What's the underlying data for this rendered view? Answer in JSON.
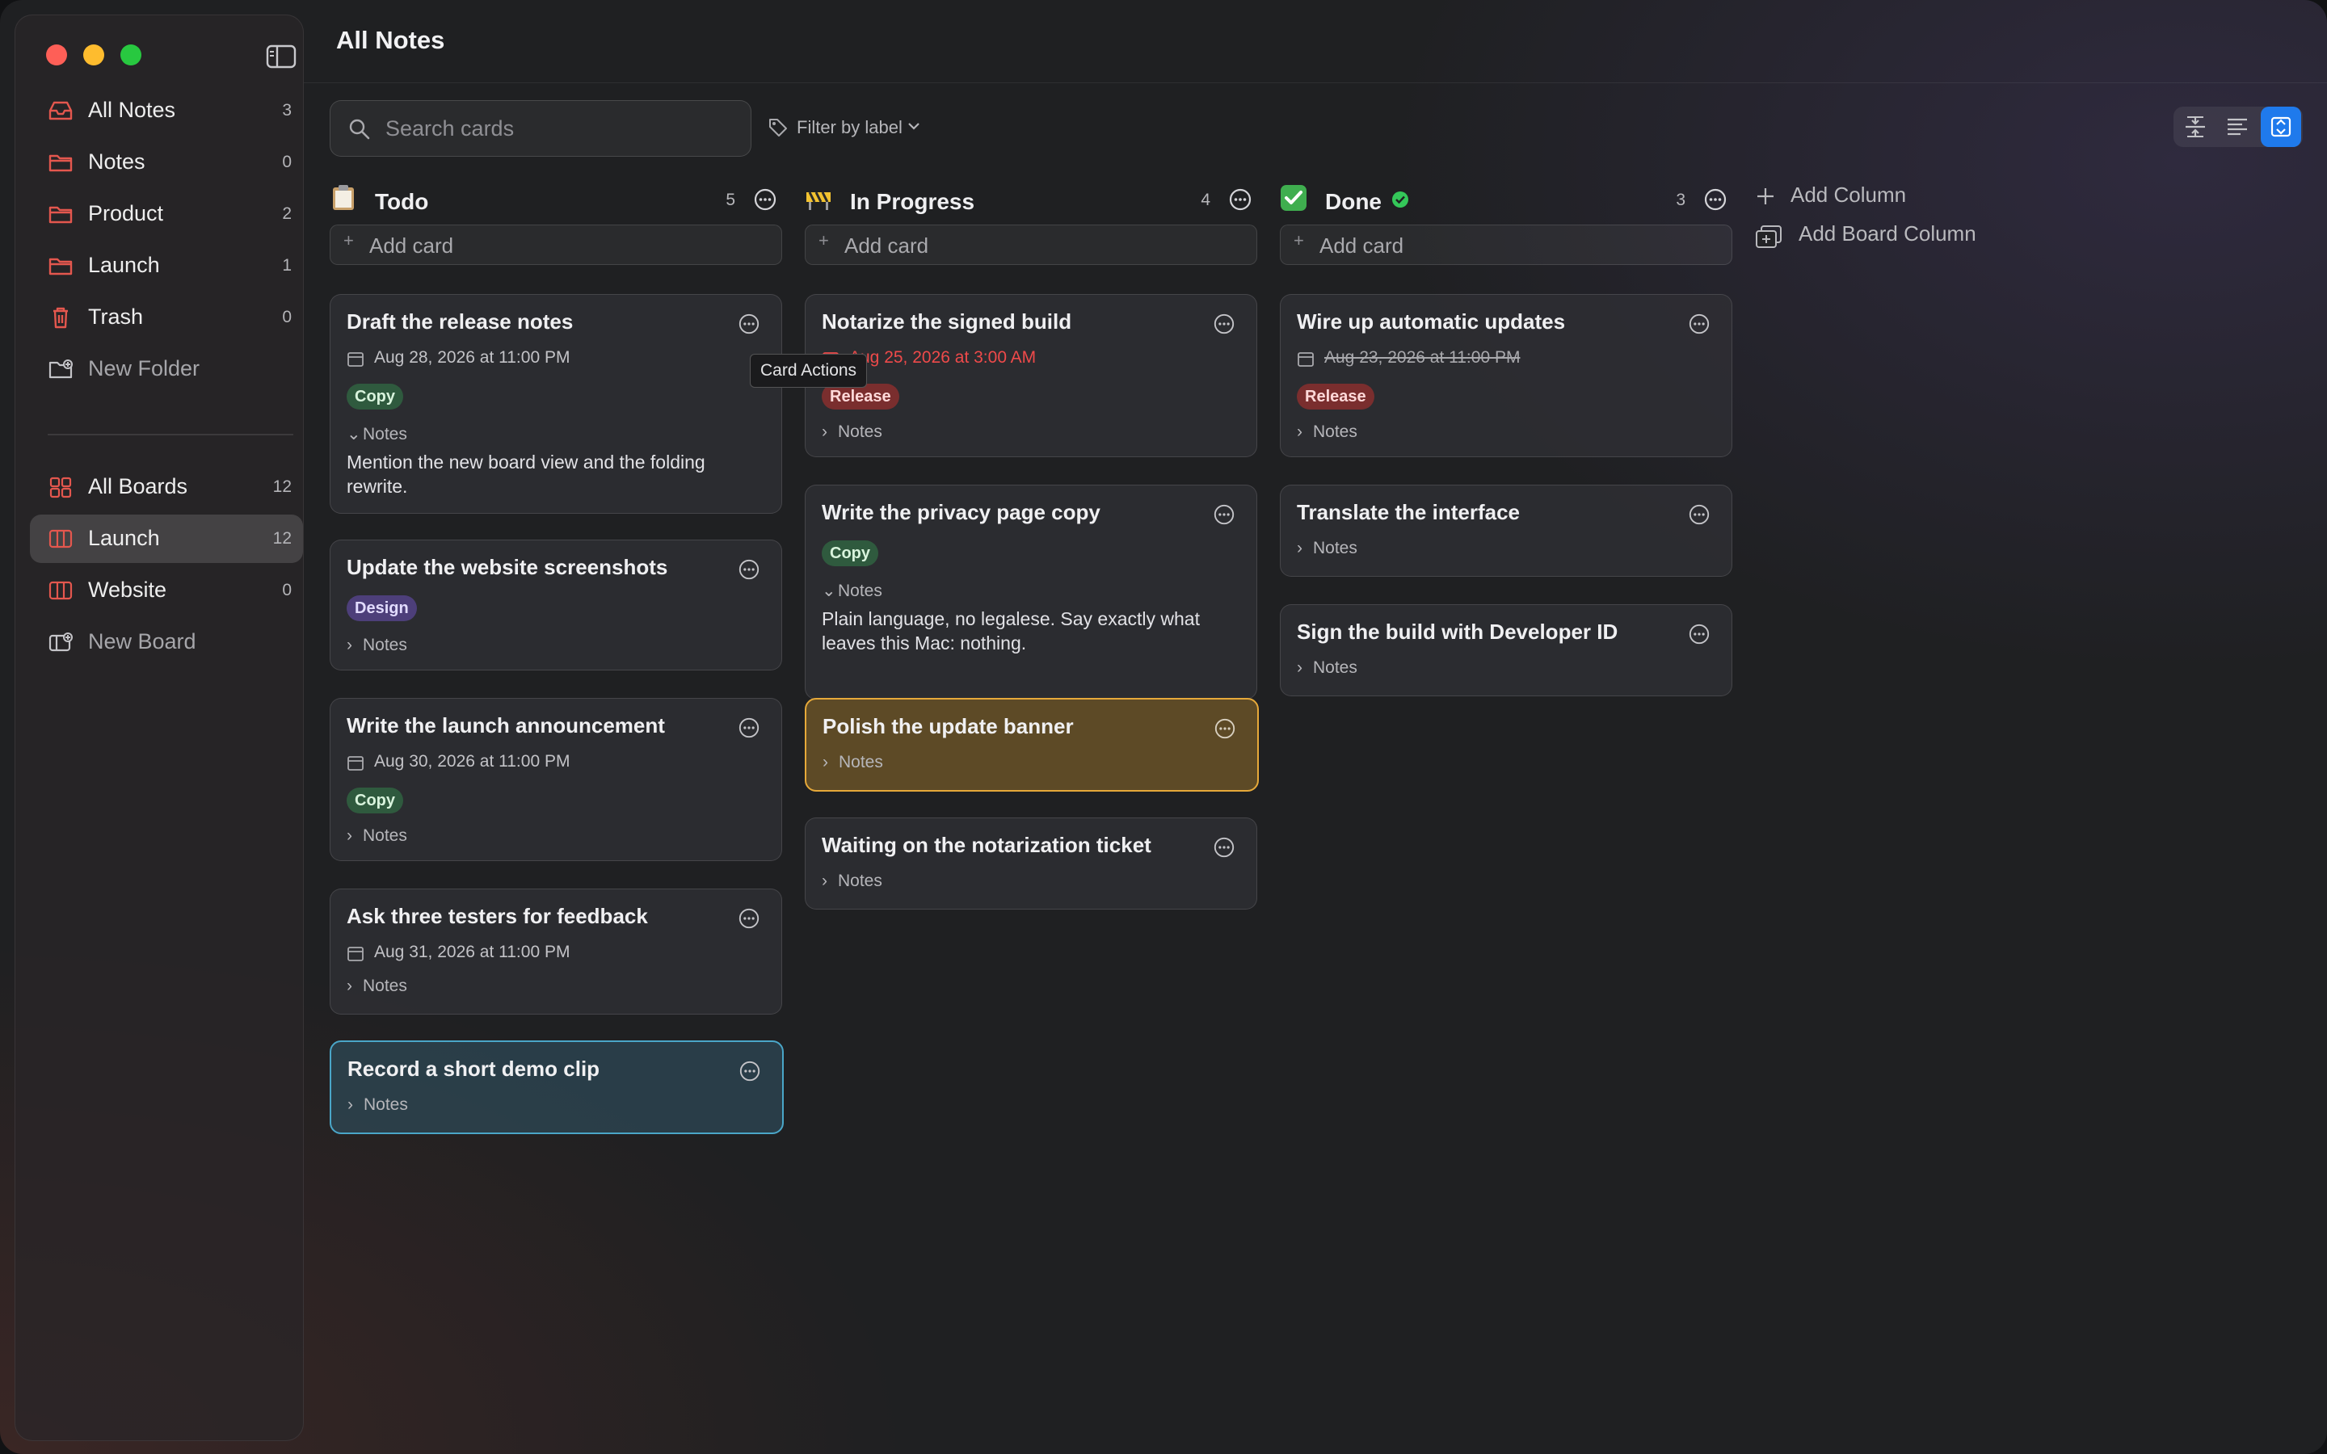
{
  "app": {
    "title": "All Notes"
  },
  "search": {
    "placeholder": "Search cards"
  },
  "filter": {
    "label": "Filter by label"
  },
  "tooltip": {
    "text": "Card Actions"
  },
  "sidebar": {
    "items": [
      {
        "label": "All Notes",
        "count": "3",
        "icon": "tray-icon"
      },
      {
        "label": "Notes",
        "count": "0",
        "icon": "folder-icon"
      },
      {
        "label": "Product",
        "count": "2",
        "icon": "folder-icon"
      },
      {
        "label": "Launch",
        "count": "1",
        "icon": "folder-icon"
      },
      {
        "label": "Trash",
        "count": "0",
        "icon": "trash-icon"
      },
      {
        "label": "New Folder",
        "icon": "new-folder-icon"
      }
    ],
    "boards": [
      {
        "label": "All Boards",
        "count": "12",
        "icon": "grid-icon"
      },
      {
        "label": "Launch",
        "count": "12",
        "icon": "board-icon",
        "active": true
      },
      {
        "label": "Website",
        "count": "0",
        "icon": "board-icon"
      },
      {
        "label": "New Board",
        "icon": "new-board-icon"
      }
    ]
  },
  "columns": [
    {
      "title": "Todo",
      "count": "5",
      "emoji": "clipboard",
      "add_label": "Add card",
      "cards": [
        {
          "title": "Draft the release notes",
          "date": "Aug 28, 2026 at 11:00 PM",
          "label": "Copy",
          "notes_label": "Notes",
          "notes_expanded": true,
          "notes": "Mention the new board view and the folding rewrite."
        },
        {
          "title": "Update the website screenshots",
          "label": "Design",
          "notes_label": "Notes"
        },
        {
          "title": "Write the launch announcement",
          "date": "Aug 30, 2026 at 11:00 PM",
          "label": "Copy",
          "notes_label": "Notes"
        },
        {
          "title": "Ask three testers for feedback",
          "date": "Aug 31, 2026 at 11:00 PM",
          "notes_label": "Notes"
        },
        {
          "title": "Record a short demo clip",
          "notes_label": "Notes",
          "color": "teal"
        }
      ]
    },
    {
      "title": "In Progress",
      "count": "4",
      "emoji": "construction",
      "add_label": "Add card",
      "cards": [
        {
          "title": "Notarize the signed build",
          "date": "Aug 25, 2026 at 3:00 AM",
          "date_overdue": true,
          "label": "Release",
          "notes_label": "Notes"
        },
        {
          "title": "Write the privacy page copy",
          "label": "Copy",
          "notes_label": "Notes",
          "notes_expanded": true,
          "notes": "Plain language, no legalese. Say exactly what leaves this Mac: nothing."
        },
        {
          "title": "Polish the update banner",
          "notes_label": "Notes",
          "color": "yellow"
        },
        {
          "title": "Waiting on the notarization ticket",
          "notes_label": "Notes"
        }
      ]
    },
    {
      "title": "Done",
      "count": "3",
      "emoji": "check-mark",
      "add_label": "Add card",
      "cards": [
        {
          "title": "Wire up automatic updates",
          "date": "Aug 23, 2026 at 11:00 PM",
          "date_done": true,
          "label": "Release",
          "notes_label": "Notes"
        },
        {
          "title": "Translate the interface",
          "notes_label": "Notes"
        },
        {
          "title": "Sign the build with Developer ID",
          "notes_label": "Notes"
        }
      ]
    }
  ],
  "board_actions": {
    "add_column": "Add Column",
    "add_board_column": "Add Board Column"
  },
  "colors": {
    "accent": "#1f7aec",
    "sidebar_icon": "#e4574e",
    "overdue": "#ef4a4a"
  }
}
